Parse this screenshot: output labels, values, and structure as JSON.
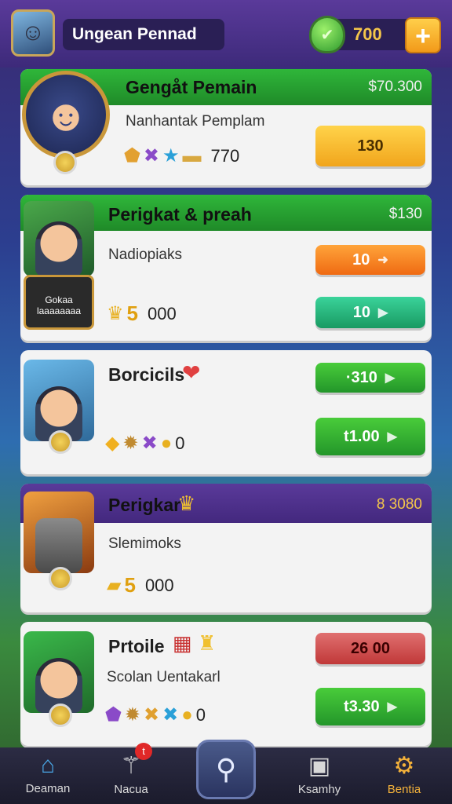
{
  "topbar": {
    "player_name": "Ungean Pennad",
    "coins": "700",
    "plus_label": "+"
  },
  "cards": [
    {
      "title": "Gengåt Pemain",
      "price": "$70.300",
      "subtitle": "Nanhantak Pemplam",
      "amount": "770",
      "button": "130"
    },
    {
      "title": "Perigkat & preah",
      "price": "$130",
      "subtitle": "Nadiopiaks",
      "badge_text": "Gokaa\nlaaaaaaaa",
      "amount_big": "5",
      "amount": "000",
      "button_top": "10",
      "button_bottom": "10"
    },
    {
      "title": "Borcicils",
      "amount": "0",
      "button_top": "·310",
      "button_bottom": "t1.00"
    },
    {
      "title": "Perigkar",
      "price": "8 3080",
      "subtitle": "Slemimoks",
      "amount_big": "5",
      "amount": "000"
    },
    {
      "title": "Prtoile",
      "subtitle": "Scolan Uentakarl",
      "amount": "0",
      "button_top": "26 00",
      "button_bottom": "t3.30"
    }
  ],
  "bottom_nav": [
    {
      "label": "Deaman",
      "icon": "home-icon"
    },
    {
      "label": "Nacua",
      "icon": "magic-wand-icon",
      "badge": "t"
    },
    {
      "label": "",
      "icon": "search-icon"
    },
    {
      "label": "Ksamhy",
      "icon": "camera-icon"
    },
    {
      "label": "Bentia",
      "icon": "gear-icon",
      "active": true
    }
  ],
  "colors": {
    "accent_green": "#1f8a28",
    "accent_purple": "#43287e",
    "gold": "#f4c64a"
  }
}
